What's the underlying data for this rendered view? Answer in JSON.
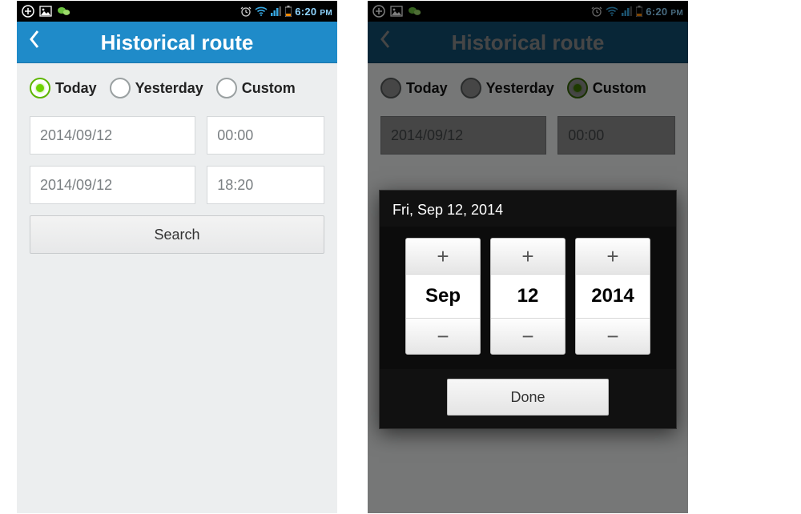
{
  "statusbar": {
    "time": "6:20",
    "ampm": "PM"
  },
  "appbar": {
    "title": "Historical route"
  },
  "screen1": {
    "radios": {
      "today": "Today",
      "yesterday": "Yesterday",
      "custom": "Custom",
      "selected": "today"
    },
    "from_date": "2014/09/12",
    "from_time": "00:00",
    "to_date": "2014/09/12",
    "to_time": "18:20",
    "search": "Search"
  },
  "screen2": {
    "radios": {
      "today": "Today",
      "yesterday": "Yesterday",
      "custom": "Custom",
      "selected": "custom"
    },
    "from_date": "2014/09/12",
    "from_time": "00:00",
    "picker": {
      "title": "Fri, Sep 12, 2014",
      "month": "Sep",
      "day": "12",
      "year": "2014",
      "done": "Done"
    }
  }
}
